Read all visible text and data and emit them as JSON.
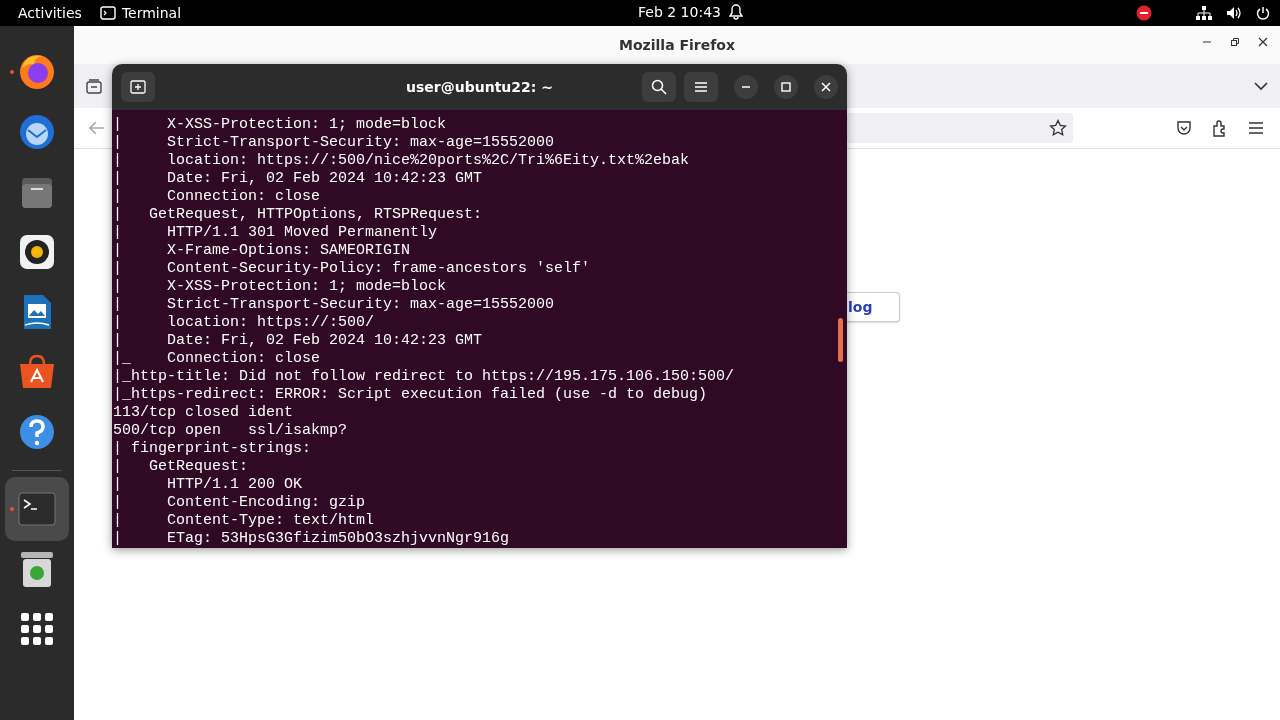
{
  "top_bar": {
    "activities": "Activities",
    "app_name": "Terminal",
    "clock": "Feb 2  10:43"
  },
  "dock": [
    {
      "kind": "firefox",
      "running": true,
      "selected": false
    },
    {
      "kind": "mail",
      "running": false,
      "selected": false
    },
    {
      "kind": "files",
      "running": false,
      "selected": false
    },
    {
      "kind": "music",
      "running": false,
      "selected": false
    },
    {
      "kind": "writer",
      "running": false,
      "selected": false
    },
    {
      "kind": "software",
      "running": false,
      "selected": false
    },
    {
      "kind": "help",
      "running": false,
      "selected": false
    },
    {
      "kind": "separator"
    },
    {
      "kind": "terminal",
      "running": true,
      "selected": true
    },
    {
      "kind": "trash",
      "running": false,
      "selected": false
    },
    {
      "kind": "apps",
      "running": false,
      "selected": false
    }
  ],
  "firefox": {
    "title": "Mozilla Firefox",
    "page_button": "log"
  },
  "terminal": {
    "title": "user@ubuntu22: ~",
    "lines": [
      "|     X-XSS-Protection: 1; mode=block",
      "|     Strict-Transport-Security: max-age=15552000",
      "|     location: https://:500/nice%20ports%2C/Tri%6Eity.txt%2ebak",
      "|     Date: Fri, 02 Feb 2024 10:42:23 GMT",
      "|     Connection: close",
      "|   GetRequest, HTTPOptions, RTSPRequest:",
      "|     HTTP/1.1 301 Moved Permanently",
      "|     X-Frame-Options: SAMEORIGIN",
      "|     Content-Security-Policy: frame-ancestors 'self'",
      "|     X-XSS-Protection: 1; mode=block",
      "|     Strict-Transport-Security: max-age=15552000",
      "|     location: https://:500/",
      "|     Date: Fri, 02 Feb 2024 10:42:23 GMT",
      "|_    Connection: close",
      "|_http-title: Did not follow redirect to https://195.175.106.150:500/",
      "|_https-redirect: ERROR: Script execution failed (use -d to debug)",
      "113/tcp closed ident",
      "500/tcp open   ssl/isakmp?",
      "| fingerprint-strings:",
      "|   GetRequest:",
      "|     HTTP/1.1 200 OK",
      "|     Content-Encoding: gzip",
      "|     Content-Type: text/html",
      "|     ETag: 53HpsG3Gfizim50bO3szhjvvnNgr916g"
    ]
  }
}
